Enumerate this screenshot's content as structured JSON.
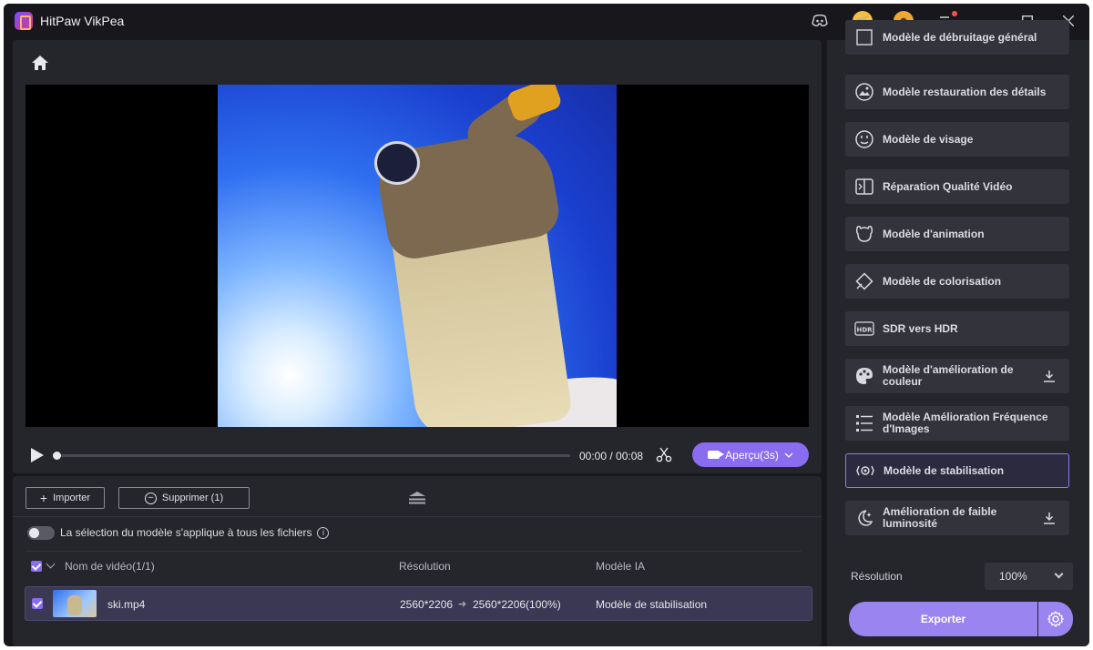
{
  "app": {
    "title": "HitPaw VikPea"
  },
  "player": {
    "time": "00:00 / 00:08",
    "preview_label": "Aperçu(3s)"
  },
  "files": {
    "import_label": "Importer",
    "delete_label": "Supprimer (1)",
    "toggle_label": "La sélection du modèle s'applique à tous les fichiers",
    "columns": {
      "name": "Nom de vidéo(1/1)",
      "resolution": "Résolution",
      "model": "Modèle IA"
    },
    "rows": [
      {
        "name": "ski.mp4",
        "res_from": "2560*2206",
        "res_to": "2560*2206(100%)",
        "model": "Modèle de stabilisation"
      }
    ]
  },
  "models": {
    "partial_top": "Modèle de débruitage général",
    "items": [
      {
        "label": "Modèle restauration des détails",
        "icon": "detail-restore-icon"
      },
      {
        "label": "Modèle de visage",
        "icon": "face-icon"
      },
      {
        "label": "Réparation Qualité Vidéo",
        "icon": "video-repair-icon"
      },
      {
        "label": "Modèle d'animation",
        "icon": "animation-icon"
      },
      {
        "label": "Modèle de colorisation",
        "icon": "colorize-icon"
      },
      {
        "label": "SDR vers HDR",
        "icon": "hdr-icon"
      },
      {
        "label": "Modèle d'amélioration de couleur",
        "icon": "palette-icon",
        "download": true
      },
      {
        "label": "Modèle Amélioration Fréquence d'Images",
        "icon": "frame-rate-icon"
      },
      {
        "label": "Modèle de stabilisation",
        "icon": "stabilization-icon",
        "active": true
      },
      {
        "label": "Amélioration de faible luminosité",
        "icon": "low-light-icon",
        "download": true
      }
    ]
  },
  "resolution": {
    "label": "Résolution",
    "value": "100%"
  },
  "export": {
    "label": "Exporter"
  },
  "colors": {
    "accent": "#8a6cf0",
    "export": "#9a84f0",
    "active_border": "#8a7cf0"
  }
}
